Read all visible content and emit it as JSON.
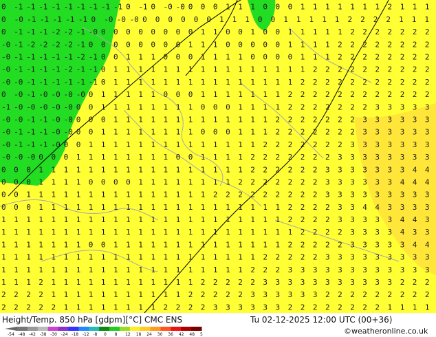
{
  "map": {
    "field_name": "Height/Temp. 850 hPa [gdpm][°C]",
    "model": "CMC ENS",
    "valid_time": "Tu 02-12-2025 12:00 UTC (00+36)",
    "credit": "©weatheronline.co.uk",
    "colors": {
      "warm_fill": "#ffff33",
      "warm_band": "#ffe23a",
      "cold_fill": "#22dd22",
      "coast": "#a8a8a8",
      "contour": "#000000"
    },
    "value_rows": [
      "0 -1 -1 -1 -1 -1 -1 -1 -1 -1 0 -1 0 -0 -0 0 0 0 1 1 1 0 0 0 1 1 1 1 1 1 1 2 1 1 1",
      "0 -0 -1 -1 -1 -1 -1 0 -0 -0 -0 0 0 0 0 0 0 1 1 1 0 0 1 1 1 1 1 2 2 2 2 1 1 1",
      "0 -1 -1 -1 -2 -2 -1 -0 0 0 0 0 0 0 0 0 1 1 0 0 1 0 0 1 1 1 1 1 2 2 2 2 2 2 2",
      "-0 -1 -2 -2 -2 -2 -1 0 0 0 0 0 0 0 0 1 1 1 0 0 0 0 0 1 1 1 1 2 2 2 2 2 2 2 2",
      "-0 -1 -1 -1 -1 -1 -2 -1 0 0 1 1 1 0 0 0 1 1 1 1 0 0 0 0 1 1 1 2 2 2 2 2 2 2 2",
      "-0 -1 -1 -1 -1 -2 -1 -1 0 1 1 1 1 1 1 1 1 1 1 1 1 1 1 1 1 2 2 2 2 2 2 2 2 2 2",
      "-0 -0 -1 -1 -1 -1 -1 -1 0 1 1 1 1 1 1 1 1 1 1 1 1 1 1 1 2 2 2 2 2 2 2 2 2 2 2",
      "0 -0 -1 -0 -0 -0 -0 0 1 1 1 1 1 0 0 0 1 1 1 1 1 1 1 2 2 2 2 2 2 2 2 2 2 2 2",
      "-1 -0 -0 -0 -0 -0 0 0 1 1 1 1 1 1 1 1 0 0 0 1 1 1 1 2 2 2 2 2 2 2 3 3 3 3 3",
      "-0 -0 -1 -1 -0 -0 0 0 0 1 1 1 1 1 1 1 1 1 1 1 1 1 2 2 2 2 2 2 2 3 3 3 3 3 3",
      "-0 -1 -1 -1 -0 -0 0 0 1 1 1 1 1 1 1 1 0 0 0 1 1 1 2 2 2 2 2 2 2 3 3 3 3 3 3",
      "-0 -1 -1 -1 -0 0 0 1 1 1 1 1 1 1 1 1 1 1 1 1 1 2 2 2 2 2 2 2 3 3 3 3 3 3 3",
      "-0 -0 -0 0 0 0 1 1 1 1 1 1 1 1 0 0 1 1 1 1 2 2 2 2 2 2 2 3 3 3 3 3 3 3 3",
      "0 0 0 1 1 1 1 1 1 1 1 1 1 1 1 1 1 1 1 1 2 2 2 2 2 2 3 3 3 3 3 3 3 4 4",
      "0 0 0 1 1 1 1 0 0 0 0 1 1 1 1 1 1 1 1 2 2 2 2 2 2 2 3 3 3 3 3 3 4 4 4",
      "0 0 1 1 1 1 1 1 1 1 1 1 1 1 1 1 1 2 2 2 2 2 2 2 2 2 3 3 3 3 3 3 3 3 3",
      "0 0 0 1 1 1 1 1 1 1 1 1 1 1 1 1 1 1 1 1 1 1 1 2 2 2 2 3 3 4 4 3 3 3 3",
      "1 1 1 1 1 1 1 1 1 1 1 1 1 1 1 1 1 1 1 1 1 1 1 2 2 2 2 3 3 3 3 3 4 4 3",
      "1 1 1 1 1 1 1 1 1 1 1 1 1 1 1 1 1 1 1 1 1 1 1 1 2 2 2 2 3 3 3 3 4 3 3",
      "1 1 1 1 1 1 1 0 0 1 1 1 1 1 1 1 1 1 1 1 1 1 1 2 2 2 2 2 3 3 3 3 3 4 4",
      "1 1 1 1 1 1 1 1 1 1 1 1 1 1 1 1 1 1 1 1 1 2 2 2 2 2 3 3 3 3 3 3 3 3 3",
      "1 1 1 1 1 1 1 1 1 1 1 1 1 1 1 1 1 1 1 1 2 2 2 3 3 3 3 3 3 3 3 3 3 3 3",
      "1 1 1 2 1 1 1 1 1 1 1 1 1 1 1 1 2 2 2 2 2 3 3 3 3 3 3 3 3 3 3 3 2 2 2",
      "2 2 2 2 1 1 1 1 1 1 1 1 1 1 1 2 2 2 2 2 3 3 3 3 3 3 2 2 2 2 2 2 2 2 2",
      "2 2 2 2 2 1 1 1 1 1 1 1 1 2 2 2 2 3 3 3 3 3 3 2 2 2 2 2 2 2 2 1 1 1 1"
    ],
    "legend": {
      "ticks": [
        "-54",
        "-48",
        "-42",
        "-38",
        "-30",
        "-24",
        "-18",
        "-12",
        "-8",
        "0",
        "8",
        "12",
        "18",
        "24",
        "30",
        "36",
        "42",
        "48",
        "54"
      ],
      "colors": [
        "#777777",
        "#999999",
        "#bbbbbb",
        "#cc44cc",
        "#8833cc",
        "#3333ff",
        "#2288ff",
        "#22bbbb",
        "#118811",
        "#22cc22",
        "#99dd22",
        "#ffee22",
        "#ffcc22",
        "#ff9922",
        "#ff5522",
        "#ee1111",
        "#aa0000",
        "#770000"
      ]
    }
  }
}
